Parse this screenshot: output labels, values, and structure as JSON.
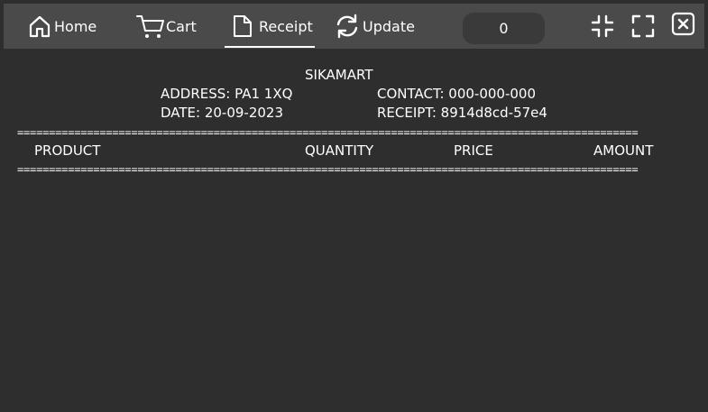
{
  "nav": {
    "home_label": "Home",
    "cart_label": "Cart",
    "receipt_label": "Receipt",
    "update_label": "Update",
    "active_tab": "receipt"
  },
  "counter": {
    "value": "0"
  },
  "window_controls": {
    "minimize_icon": "compress-icon",
    "maximize_icon": "expand-icon",
    "close_icon": "close-icon"
  },
  "receipt": {
    "store_name": "SIKAMART",
    "address": "ADDRESS: PA1 1XQ",
    "contact": "CONTACT: 000-000-000",
    "date": "DATE: 20-09-2023",
    "receipt_id": "RECEIPT: 8914d8cd-57e4",
    "divider": "==================================================================================================",
    "columns": {
      "product": "PRODUCT",
      "quantity": "QUANTITY",
      "price": "PRICE",
      "amount": "AMOUNT"
    },
    "items": []
  },
  "colors": {
    "background": "#2e2e2e",
    "topbar": "#4a4a4a",
    "counter_bg": "#3a3a3a",
    "text": "#ffffff"
  }
}
